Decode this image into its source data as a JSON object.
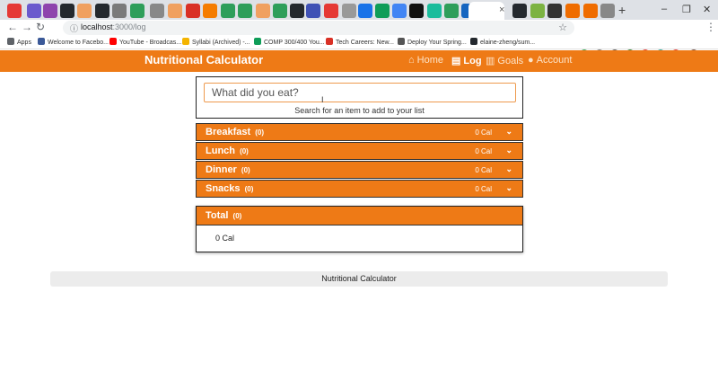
{
  "browser": {
    "url_host": "localhost",
    "url_path": ":3000/log",
    "new_tab": "+",
    "tab_close": "×",
    "window_controls": [
      "–",
      "❐",
      "✕"
    ],
    "bookmarks": [
      {
        "label": "Apps",
        "color": "#5f6368"
      },
      {
        "label": "Welcome to Facebo...",
        "color": "#3b5998"
      },
      {
        "label": "YouTube - Broadcas...",
        "color": "#ff0000"
      },
      {
        "label": "Syllabi (Archived) -...",
        "color": "#f4b400"
      },
      {
        "label": "COMP 300/400 You...",
        "color": "#0f9d58"
      },
      {
        "label": "Tech Careers: New...",
        "color": "#d93025"
      },
      {
        "label": "Deploy Your Spring...",
        "color": "#555555"
      },
      {
        "label": "elaine-zheng/sum...",
        "color": "#24292e"
      }
    ]
  },
  "app": {
    "brand": "Nutritional Calculator",
    "nav": [
      {
        "label": "Home",
        "icon": "home-icon",
        "glyph": "⌂",
        "active": false
      },
      {
        "label": "Log",
        "icon": "book-icon",
        "glyph": "▤",
        "active": true
      },
      {
        "label": "Goals",
        "icon": "chart-icon",
        "glyph": "▥",
        "active": false
      },
      {
        "label": "Account",
        "icon": "user-icon",
        "glyph": "●",
        "active": false
      }
    ],
    "accent": "#ee7a16"
  },
  "search": {
    "placeholder": "What did you eat?",
    "hint": "Search for an item to add to your list"
  },
  "meals": [
    {
      "name": "Breakfast",
      "count": "(0)",
      "calories": "0 Cal"
    },
    {
      "name": "Lunch",
      "count": "(0)",
      "calories": "0 Cal"
    },
    {
      "name": "Dinner",
      "count": "(0)",
      "calories": "0 Cal"
    },
    {
      "name": "Snacks",
      "count": "(0)",
      "calories": "0 Cal"
    }
  ],
  "total": {
    "label": "Total",
    "count": "(0)",
    "calories": "0 Cal"
  },
  "footer": {
    "text": "Nutritional Calculator"
  }
}
